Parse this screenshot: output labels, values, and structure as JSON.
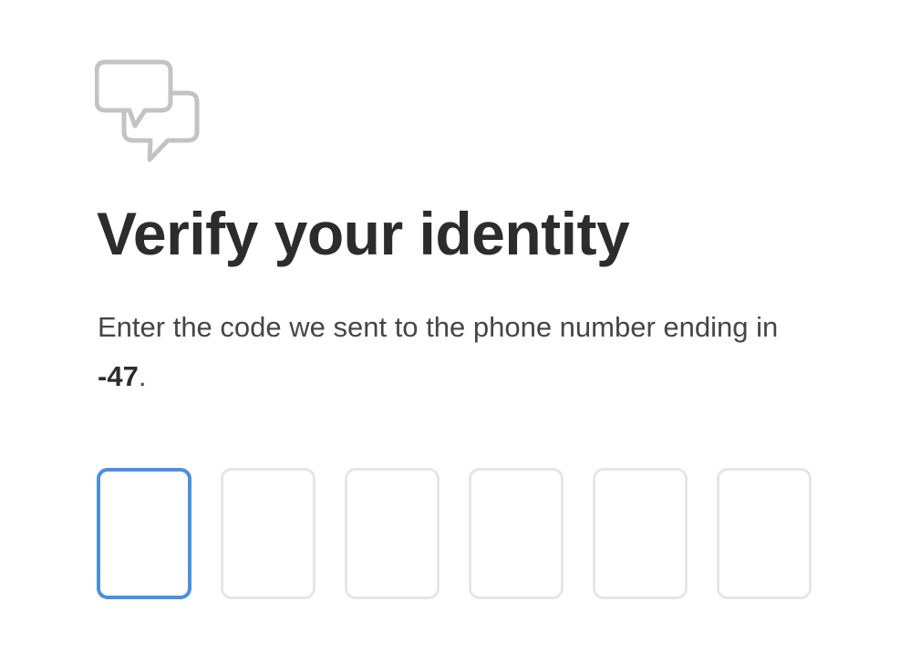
{
  "header": {
    "icon": "chat-bubbles-icon",
    "title": "Verify your identity"
  },
  "instructions": {
    "text_before": "Enter the code we sent to the phone number ending in ",
    "phone_suffix": "-47",
    "text_after": "."
  },
  "code_input": {
    "digits": [
      "",
      "",
      "",
      "",
      "",
      ""
    ],
    "active_index": 0,
    "active_border_color": "#4b8fe2",
    "inactive_border_color": "#e6e6e6"
  }
}
